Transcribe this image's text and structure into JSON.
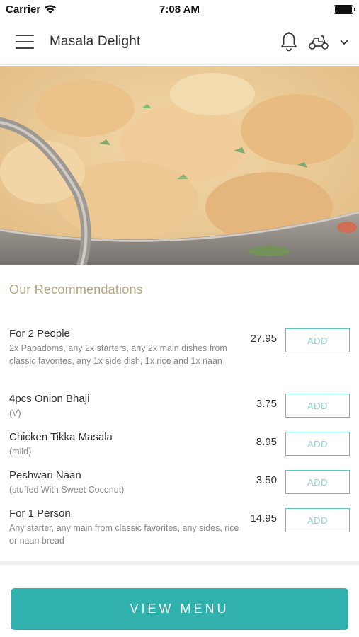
{
  "status_bar": {
    "carrier": "Carrier",
    "time": "7:08 AM"
  },
  "header": {
    "title": "Masala Delight",
    "icons": [
      "menu-icon",
      "bell-icon",
      "scooter-icon",
      "chevron-down-icon"
    ]
  },
  "hero_image": {
    "alt": "Curry dish in a pan",
    "colors": {
      "base": "#e9c58d",
      "pan": "#7a7670"
    }
  },
  "section": {
    "title": "Our Recommendations"
  },
  "items": [
    {
      "name": "For 2 People",
      "desc": "2x Papadoms, any 2x starters, any 2x main dishes from classic favorites, any 1x side dish, 1x rice and 1x naan",
      "price": "27.95",
      "add_label": "ADD"
    },
    {
      "name": "4pcs Onion Bhaji",
      "desc": "(V)",
      "price": "3.75",
      "add_label": "ADD"
    },
    {
      "name": "Chicken Tikka Masala",
      "desc": "(mild)",
      "price": "8.95",
      "add_label": "ADD"
    },
    {
      "name": "Peshwari Naan",
      "desc": "(stuffed With Sweet Coconut)",
      "price": "3.50",
      "add_label": "ADD"
    },
    {
      "name": "For 1 Person",
      "desc": "Any starter, any main from classic favorites, any sides, rice or naan bread",
      "price": "14.95",
      "add_label": "ADD"
    }
  ],
  "footer": {
    "view_menu_label": "VIEW MENU"
  },
  "colors": {
    "accent": "#31b1ae",
    "section_title": "#b4a47e",
    "add_border": "#5fc3c0"
  }
}
